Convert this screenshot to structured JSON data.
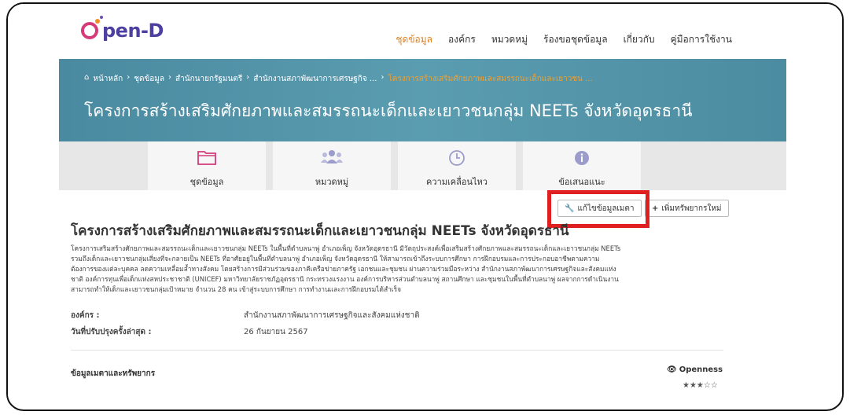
{
  "logo": {
    "text": "pen-D"
  },
  "nav": {
    "items": [
      {
        "label": "ชุดข้อมูล",
        "active": true
      },
      {
        "label": "องค์กร",
        "active": false
      },
      {
        "label": "หมวดหมู่",
        "active": false
      },
      {
        "label": "ร้องขอชุดข้อมูล",
        "active": false
      },
      {
        "label": "เกี่ยวกับ",
        "active": false
      },
      {
        "label": "คู่มือการใช้งาน",
        "active": false
      }
    ]
  },
  "breadcrumb": {
    "home": "หน้าหลัก",
    "items": [
      "ชุดข้อมูล",
      "สำนักนายกรัฐมนตรี",
      "สำนักงานสภาพัฒนาการเศรษฐกิจ ...",
      "โครงการสร้างเสริมศักยภาพและสมรรถนะเด็กและเยาวชน ..."
    ]
  },
  "hero": {
    "title": "โครงการสร้างเสริมศักยภาพและสมรรถนะเด็กและเยาวชนกลุ่ม NEETs จังหวัดอุดรธานี"
  },
  "tabs": [
    {
      "label": "ชุดข้อมูล",
      "icon": "folder-icon"
    },
    {
      "label": "หมวดหมู่",
      "icon": "users-icon"
    },
    {
      "label": "ความเคลื่อนไหว",
      "icon": "clock-icon"
    },
    {
      "label": "ข้อเสนอแนะ",
      "icon": "info-icon"
    }
  ],
  "actions": {
    "edit_metadata": "แก้ไขข้อมูลเมตา",
    "add_resource": "เพิ่มทรัพยากรใหม่"
  },
  "dataset": {
    "title": "โครงการสร้างเสริมศักยภาพและสมรรถนะเด็กและเยาวชนกลุ่ม NEETs จังหวัดอุดรธานี",
    "description_lines": [
      "โครงการเสริมสร้างศักยภาพและสมรรถนะเด็กและเยาวชนกลุ่ม NEETs ในพื้นที่ตำบลนาพู่ อำเภอเพ็ญ จังหวัดอุดรธานี มีวัตถุประสงค์เพื่อเสริมสร้างศักยภาพและสมรรถนะเด็กและเยาวชนกลุ่ม NEETs",
      "รวมถึงเด็กและเยาวชนกลุ่มเสี่ยงที่จะกลายเป็น NEETs ที่อาศัยอยู่ในพื้นที่ตำบลนาพู่ อำเภอเพ็ญ จังหวัดอุดรธานี ให้สามารถเข้าถึงระบบการศึกษา การฝึกอบรมและการประกอบอาชีพตามความ",
      "ต้องการของแต่ละบุคคล ลดความเหลื่อมล้ำทางสังคม โดยสร้างการมีส่วนร่วมของภาคีเครือข่ายภาครัฐ เอกชนและชุมชน ผ่านความร่วมมือระหว่าง สำนักงานสภาพัฒนาการเศรษฐกิจและสังคมแห่ง",
      "ชาติ องค์การทุนเพื่อเด็กแห่งสหประชาชาติ (UNICEF) มหาวิทยาลัยราชภัฏอุดรธานี กระทรวงแรงงาน องค์การบริหารส่วนตำบลนาพู่ สถานศึกษา และชุมชนในพื้นที่ตำบลนาพู่ ผลจากการดำเนินงาน",
      "สามารถทำให้เด็กและเยาวชนกลุ่มเป้าหมาย จำนวน 28 คน เข้าสู่ระบบการศึกษา การทำงานและการฝึกอบรมได้สำเร็จ"
    ],
    "org_label": "องค์กร :",
    "org_value": "สำนักงานสภาพัฒนาการเศรษฐกิจและสังคมแห่งชาติ",
    "updated_label": "วันที่ปรับปรุงครั้งล่าสุด :",
    "updated_value": "26 กันยายน 2567"
  },
  "metadata_section": {
    "title": "ข้อมูลเมตาและทรัพยากร",
    "openness_label": "Openness",
    "openness_stars": "★★★☆☆"
  },
  "colors": {
    "accent": "#e0821f",
    "hero": "#4f8fa4",
    "highlight": "#e02020",
    "brand": "#4d3fa0"
  }
}
